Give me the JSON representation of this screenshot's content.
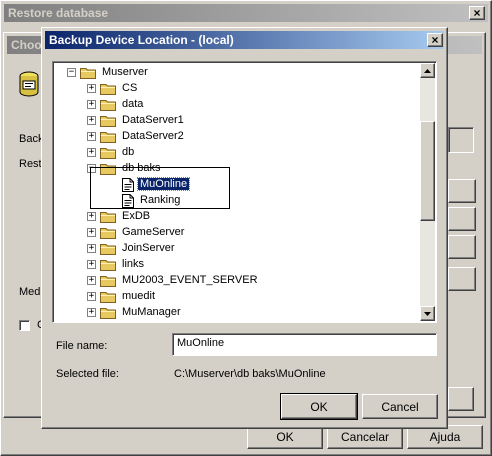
{
  "back_window": {
    "title": "Restore database",
    "ok_label": "OK",
    "cancel_label": "Cancelar",
    "help_label": "Ajuda"
  },
  "middle_window": {
    "title": "Choos",
    "backup_label": "Back",
    "restore_label": "Rest",
    "media_label": "Medi",
    "option_label": "C"
  },
  "dialog": {
    "title": "Backup Device Location - (local)",
    "close_glyph": "×",
    "tree": [
      {
        "label": "Muserver",
        "expander": "−",
        "type": "folder"
      },
      {
        "label": "CS",
        "expander": "+",
        "type": "folder"
      },
      {
        "label": "data",
        "expander": "+",
        "type": "folder"
      },
      {
        "label": "DataServer1",
        "expander": "+",
        "type": "folder"
      },
      {
        "label": "DataServer2",
        "expander": "+",
        "type": "folder"
      },
      {
        "label": "db",
        "expander": "+",
        "type": "folder"
      },
      {
        "label": "db baks",
        "expander": "−",
        "type": "folder"
      },
      {
        "label": "MuOnline",
        "expander": "",
        "type": "file",
        "selected": true
      },
      {
        "label": "Ranking",
        "expander": "",
        "type": "file"
      },
      {
        "label": "ExDB",
        "expander": "+",
        "type": "folder"
      },
      {
        "label": "GameServer",
        "expander": "+",
        "type": "folder"
      },
      {
        "label": "JoinServer",
        "expander": "+",
        "type": "folder"
      },
      {
        "label": "links",
        "expander": "+",
        "type": "folder"
      },
      {
        "label": "MU2003_EVENT_SERVER",
        "expander": "+",
        "type": "folder"
      },
      {
        "label": "muedit",
        "expander": "+",
        "type": "folder"
      },
      {
        "label": "MuManager",
        "expander": "+",
        "type": "folder"
      }
    ],
    "file_name_label": "File name:",
    "file_name_value": "MuOnline",
    "selected_file_label": "Selected file:",
    "selected_file_value": "C:\\Muserver\\db baks\\MuOnline",
    "ok_label": "OK",
    "cancel_label": "Cancel"
  },
  "colors": {
    "face": "#d4d0c8",
    "active_title": "#0a246a",
    "selection": "#0a246a",
    "folder": "#e8c860"
  }
}
